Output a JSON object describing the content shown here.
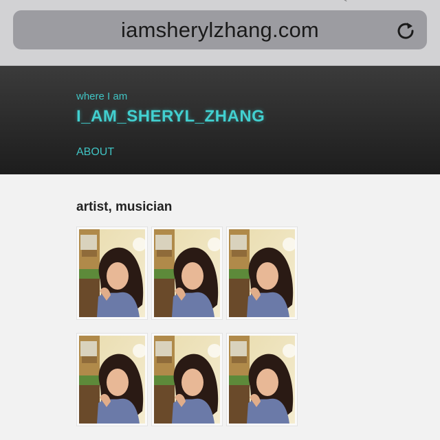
{
  "browser": {
    "url": "iamsherylzhang.com",
    "reload_icon": "reload-icon"
  },
  "header": {
    "tagline": "where I am",
    "site_title": "I_AM_SHERYL_ZHANG",
    "nav": [
      {
        "label": "ABOUT"
      }
    ]
  },
  "content": {
    "heading": "artist, musician",
    "photo_count": 6,
    "photo_icon": "portrait-photo"
  }
}
